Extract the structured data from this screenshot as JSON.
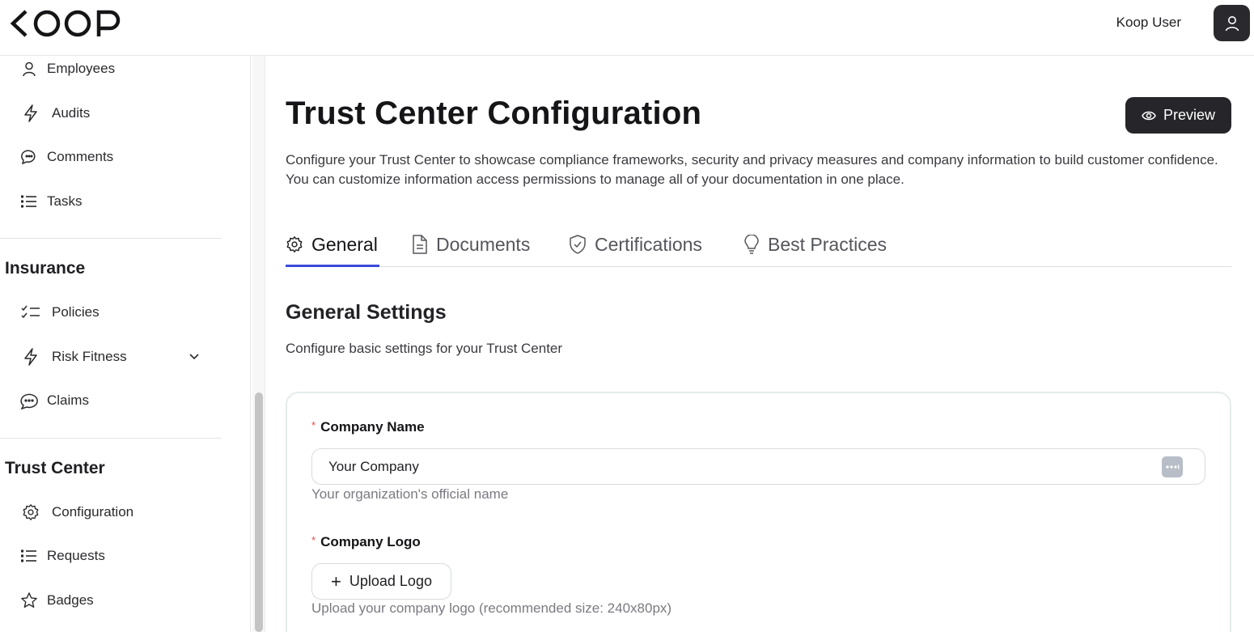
{
  "header": {
    "logo_text": "KOOP",
    "user_name": "Koop User"
  },
  "sidebar": {
    "items_top": [
      {
        "label": "Employees",
        "icon": "user-icon"
      },
      {
        "label": "Audits",
        "icon": "lightning-icon"
      },
      {
        "label": "Comments",
        "icon": "comments-icon"
      },
      {
        "label": "Tasks",
        "icon": "list-icon"
      }
    ],
    "insurance": {
      "title": "Insurance",
      "items": [
        {
          "label": "Policies",
          "icon": "checklist-icon"
        },
        {
          "label": "Risk Fitness",
          "icon": "lightning-icon"
        },
        {
          "label": "Claims",
          "icon": "chat-icon"
        }
      ]
    },
    "trust_center": {
      "title": "Trust Center",
      "items": [
        {
          "label": "Configuration",
          "icon": "gear-icon"
        },
        {
          "label": "Requests",
          "icon": "list-icon"
        },
        {
          "label": "Badges",
          "icon": "star-icon"
        }
      ]
    }
  },
  "main": {
    "title": "Trust Center Configuration",
    "preview_label": "Preview",
    "description": "Configure your Trust Center to showcase compliance frameworks, security and privacy measures and company information to build customer confidence. You can customize information access permissions to manage all of your documentation in one place.",
    "tabs": [
      {
        "label": "General",
        "icon": "gear-icon",
        "active": true
      },
      {
        "label": "Documents",
        "icon": "document-icon"
      },
      {
        "label": "Certifications",
        "icon": "shield-check-icon"
      },
      {
        "label": "Best Practices",
        "icon": "lightbulb-icon"
      }
    ],
    "section_title": "General Settings",
    "section_subtitle": "Configure basic settings for your Trust Center",
    "form": {
      "required_mark": "*",
      "company_name_label": "Company Name",
      "company_name_value": "Your Company",
      "company_name_hint": "Your organization's official name",
      "company_logo_label": "Company Logo",
      "upload_label": "Upload Logo",
      "upload_plus": "+",
      "company_logo_hint": "Upload your company logo (recommended size: 240x80px)"
    }
  },
  "colors": {
    "accent": "#3b4bdb",
    "dark_button": "#25252a",
    "required": "#e24b4b"
  }
}
